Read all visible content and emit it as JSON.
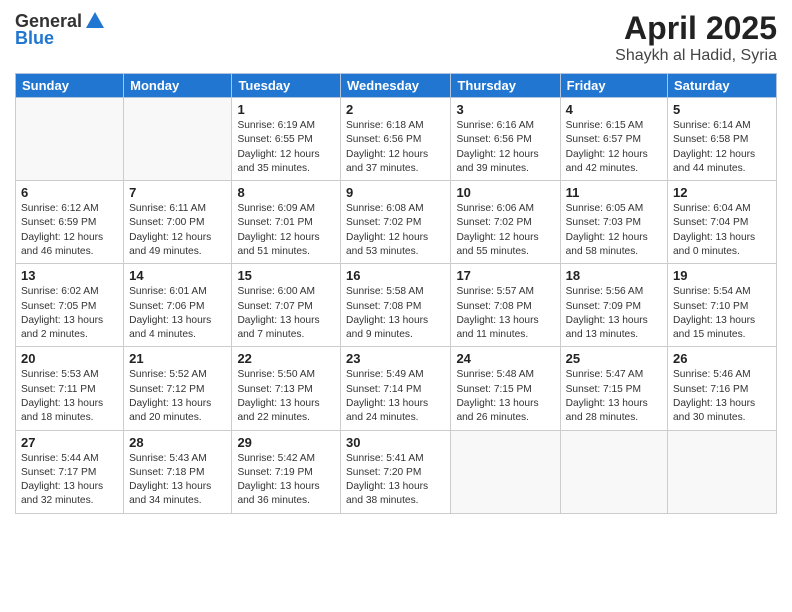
{
  "header": {
    "logo_general": "General",
    "logo_blue": "Blue",
    "month_title": "April 2025",
    "subtitle": "Shaykh al Hadid, Syria"
  },
  "days_of_week": [
    "Sunday",
    "Monday",
    "Tuesday",
    "Wednesday",
    "Thursday",
    "Friday",
    "Saturday"
  ],
  "weeks": [
    [
      {
        "day": "",
        "info": ""
      },
      {
        "day": "",
        "info": ""
      },
      {
        "day": "1",
        "info": "Sunrise: 6:19 AM\nSunset: 6:55 PM\nDaylight: 12 hours and 35 minutes."
      },
      {
        "day": "2",
        "info": "Sunrise: 6:18 AM\nSunset: 6:56 PM\nDaylight: 12 hours and 37 minutes."
      },
      {
        "day": "3",
        "info": "Sunrise: 6:16 AM\nSunset: 6:56 PM\nDaylight: 12 hours and 39 minutes."
      },
      {
        "day": "4",
        "info": "Sunrise: 6:15 AM\nSunset: 6:57 PM\nDaylight: 12 hours and 42 minutes."
      },
      {
        "day": "5",
        "info": "Sunrise: 6:14 AM\nSunset: 6:58 PM\nDaylight: 12 hours and 44 minutes."
      }
    ],
    [
      {
        "day": "6",
        "info": "Sunrise: 6:12 AM\nSunset: 6:59 PM\nDaylight: 12 hours and 46 minutes."
      },
      {
        "day": "7",
        "info": "Sunrise: 6:11 AM\nSunset: 7:00 PM\nDaylight: 12 hours and 49 minutes."
      },
      {
        "day": "8",
        "info": "Sunrise: 6:09 AM\nSunset: 7:01 PM\nDaylight: 12 hours and 51 minutes."
      },
      {
        "day": "9",
        "info": "Sunrise: 6:08 AM\nSunset: 7:02 PM\nDaylight: 12 hours and 53 minutes."
      },
      {
        "day": "10",
        "info": "Sunrise: 6:06 AM\nSunset: 7:02 PM\nDaylight: 12 hours and 55 minutes."
      },
      {
        "day": "11",
        "info": "Sunrise: 6:05 AM\nSunset: 7:03 PM\nDaylight: 12 hours and 58 minutes."
      },
      {
        "day": "12",
        "info": "Sunrise: 6:04 AM\nSunset: 7:04 PM\nDaylight: 13 hours and 0 minutes."
      }
    ],
    [
      {
        "day": "13",
        "info": "Sunrise: 6:02 AM\nSunset: 7:05 PM\nDaylight: 13 hours and 2 minutes."
      },
      {
        "day": "14",
        "info": "Sunrise: 6:01 AM\nSunset: 7:06 PM\nDaylight: 13 hours and 4 minutes."
      },
      {
        "day": "15",
        "info": "Sunrise: 6:00 AM\nSunset: 7:07 PM\nDaylight: 13 hours and 7 minutes."
      },
      {
        "day": "16",
        "info": "Sunrise: 5:58 AM\nSunset: 7:08 PM\nDaylight: 13 hours and 9 minutes."
      },
      {
        "day": "17",
        "info": "Sunrise: 5:57 AM\nSunset: 7:08 PM\nDaylight: 13 hours and 11 minutes."
      },
      {
        "day": "18",
        "info": "Sunrise: 5:56 AM\nSunset: 7:09 PM\nDaylight: 13 hours and 13 minutes."
      },
      {
        "day": "19",
        "info": "Sunrise: 5:54 AM\nSunset: 7:10 PM\nDaylight: 13 hours and 15 minutes."
      }
    ],
    [
      {
        "day": "20",
        "info": "Sunrise: 5:53 AM\nSunset: 7:11 PM\nDaylight: 13 hours and 18 minutes."
      },
      {
        "day": "21",
        "info": "Sunrise: 5:52 AM\nSunset: 7:12 PM\nDaylight: 13 hours and 20 minutes."
      },
      {
        "day": "22",
        "info": "Sunrise: 5:50 AM\nSunset: 7:13 PM\nDaylight: 13 hours and 22 minutes."
      },
      {
        "day": "23",
        "info": "Sunrise: 5:49 AM\nSunset: 7:14 PM\nDaylight: 13 hours and 24 minutes."
      },
      {
        "day": "24",
        "info": "Sunrise: 5:48 AM\nSunset: 7:15 PM\nDaylight: 13 hours and 26 minutes."
      },
      {
        "day": "25",
        "info": "Sunrise: 5:47 AM\nSunset: 7:15 PM\nDaylight: 13 hours and 28 minutes."
      },
      {
        "day": "26",
        "info": "Sunrise: 5:46 AM\nSunset: 7:16 PM\nDaylight: 13 hours and 30 minutes."
      }
    ],
    [
      {
        "day": "27",
        "info": "Sunrise: 5:44 AM\nSunset: 7:17 PM\nDaylight: 13 hours and 32 minutes."
      },
      {
        "day": "28",
        "info": "Sunrise: 5:43 AM\nSunset: 7:18 PM\nDaylight: 13 hours and 34 minutes."
      },
      {
        "day": "29",
        "info": "Sunrise: 5:42 AM\nSunset: 7:19 PM\nDaylight: 13 hours and 36 minutes."
      },
      {
        "day": "30",
        "info": "Sunrise: 5:41 AM\nSunset: 7:20 PM\nDaylight: 13 hours and 38 minutes."
      },
      {
        "day": "",
        "info": ""
      },
      {
        "day": "",
        "info": ""
      },
      {
        "day": "",
        "info": ""
      }
    ]
  ]
}
